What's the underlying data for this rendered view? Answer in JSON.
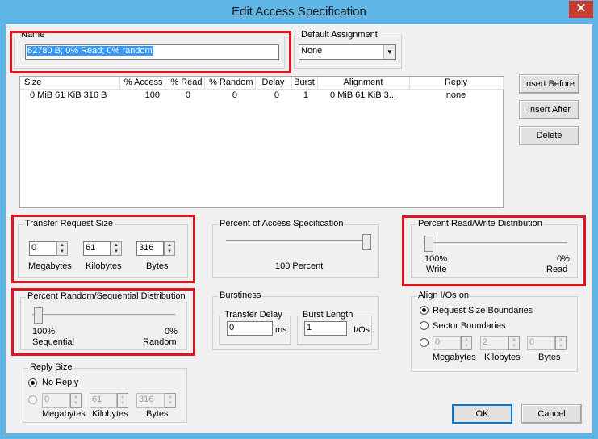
{
  "window": {
    "title": "Edit Access Specification",
    "close_glyph": "✕"
  },
  "name_group": {
    "label": "Name",
    "value": "62780 B; 0% Read; 0% random"
  },
  "default_assignment": {
    "label": "Default Assignment",
    "value": "None"
  },
  "table": {
    "columns": [
      "Size",
      "% Access",
      "% Read",
      "% Random",
      "Delay",
      "Burst",
      "Alignment",
      "Reply"
    ],
    "rows": [
      [
        "0 MiB   61 KiB   316 B",
        "100",
        "0",
        "0",
        "0",
        "1",
        "0 MiB   61 KiB   3...",
        "none"
      ]
    ]
  },
  "buttons": {
    "insert_before": "Insert Before",
    "insert_after": "Insert After",
    "delete": "Delete",
    "ok": "OK",
    "cancel": "Cancel"
  },
  "transfer_size": {
    "label": "Transfer Request Size",
    "megabytes": "0",
    "kilobytes": "61",
    "bytes": "316",
    "mb_label": "Megabytes",
    "kb_label": "Kilobytes",
    "b_label": "Bytes"
  },
  "percent_access": {
    "label": "Percent of Access Specification",
    "value_text": "100 Percent",
    "level": 100
  },
  "read_write": {
    "label": "Percent Read/Write Distribution",
    "left_pct": "100%",
    "left_name": "Write",
    "right_pct": "0%",
    "right_name": "Read",
    "read_percent": 0
  },
  "random_sequential": {
    "label": "Percent Random/Sequential Distribution",
    "left_pct": "100%",
    "left_name": "Sequential",
    "right_pct": "0%",
    "right_name": "Random",
    "random_percent": 0
  },
  "burstiness": {
    "label": "Burstiness",
    "transfer_delay_label": "Transfer Delay",
    "transfer_delay_value": "0",
    "delay_unit": "ms",
    "burst_length_label": "Burst Length",
    "burst_length_value": "1",
    "burst_unit": "I/Os"
  },
  "align": {
    "label": "Align I/Os on",
    "option_request": "Request Size Boundaries",
    "option_sector": "Sector Boundaries",
    "megabytes": "0",
    "kilobytes": "2",
    "bytes": "0",
    "mb_label": "Megabytes",
    "kb_label": "Kilobytes",
    "b_label": "Bytes",
    "selected": "Request Size Boundaries"
  },
  "reply": {
    "label": "Reply Size",
    "option_no_reply": "No Reply",
    "megabytes": "0",
    "kilobytes": "61",
    "bytes": "316",
    "mb_label": "Megabytes",
    "kb_label": "Kilobytes",
    "b_label": "Bytes",
    "selected": "No Reply"
  },
  "colors": {
    "titlebar": "#5fb5e6",
    "close": "#c73c31",
    "highlight": "#e0141e",
    "selection": "#3399ff"
  }
}
